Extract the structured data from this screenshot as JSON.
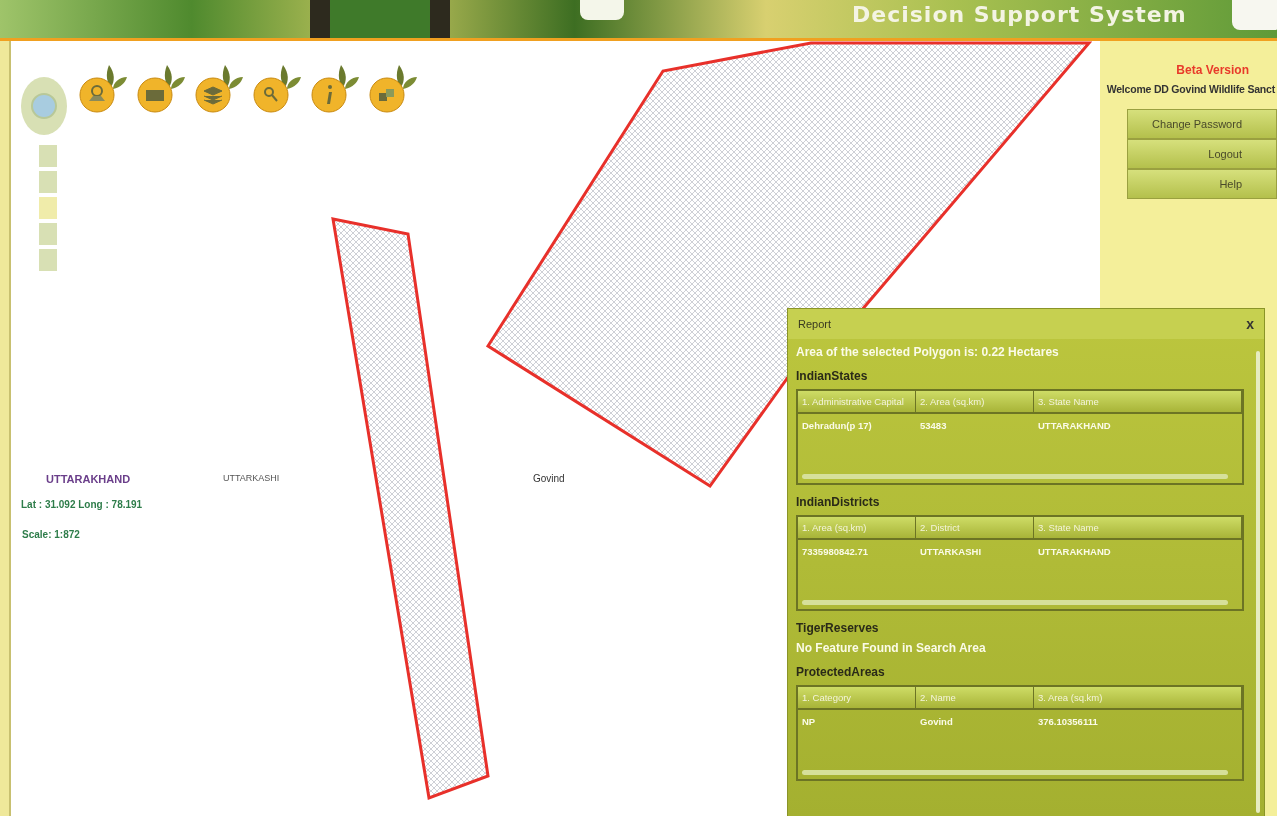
{
  "header": {
    "title": "Decision Support System"
  },
  "map": {
    "labels": [
      {
        "kind": "state",
        "text": "UTTARAKHAND"
      },
      {
        "kind": "district",
        "text": "UTTARKASHI"
      },
      {
        "kind": "area",
        "text": "Govind"
      }
    ],
    "coordinates": "Lat : 31.092 Long : 78.191",
    "scale": "Scale: 1:872"
  },
  "sidebar": {
    "beta": "Beta Version",
    "welcome": "Welcome DD Govind Wildlife Sanct",
    "buttons": [
      "Change Password",
      "Logout",
      "Help"
    ]
  },
  "report": {
    "title": "Report",
    "close": "x",
    "summary": "Area of the selected Polygon is: 0.22 Hectares",
    "sections": [
      {
        "kind": "table",
        "name": "IndianStates",
        "columns": [
          "1. Administrative Capital",
          "2. Area (sq.km)",
          "3. State Name"
        ],
        "rows": [
          [
            "Dehradun(p 17)",
            "53483",
            "UTTARAKHAND"
          ]
        ]
      },
      {
        "kind": "table",
        "name": "IndianDistricts",
        "columns": [
          "1. Area (sq.km)",
          "2. District",
          "3. State Name"
        ],
        "rows": [
          [
            "7335980842.71",
            "UTTARKASHI",
            "UTTARAKHAND"
          ]
        ]
      },
      {
        "kind": "message",
        "name": "TigerReserves",
        "message": "No Feature Found in Search Area"
      },
      {
        "kind": "table",
        "name": "ProtectedAreas",
        "columns": [
          "1. Category",
          "2. Name",
          "3. Area (sq.km)"
        ],
        "rows": [
          [
            "NP",
            "Govind",
            "376.10356111"
          ]
        ]
      }
    ]
  }
}
